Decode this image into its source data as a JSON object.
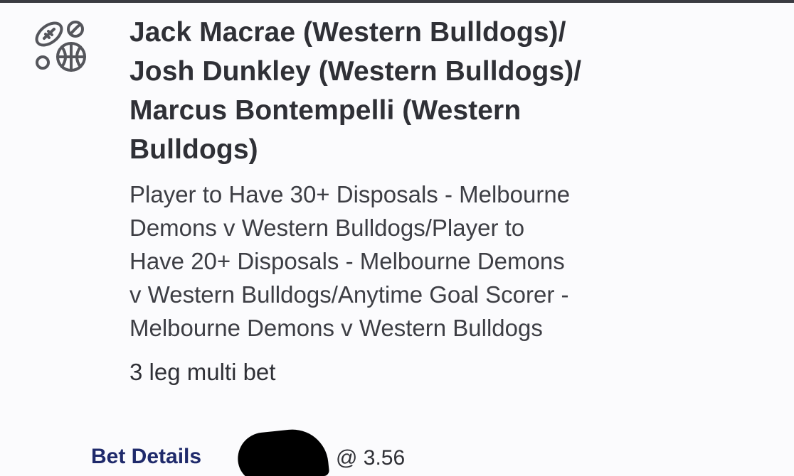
{
  "bet": {
    "title_lines": [
      "Jack Macrae (Western Bulldogs)/",
      "Josh Dunkley (Western Bulldogs)/",
      "Marcus Bontempelli (Western",
      "Bulldogs)"
    ],
    "description_lines": [
      "Player to Have 30+ Disposals - Melbourne",
      "Demons v Western Bulldogs/Player to",
      "Have 20+ Disposals - Melbourne Demons",
      "v Western Bulldogs/Anytime Goal Scorer -",
      "Melbourne Demons v Western Bulldogs"
    ],
    "bet_type": "3 leg multi bet"
  },
  "footer": {
    "details_label": "Bet Details",
    "odds_text": "@ 3.56"
  },
  "icon": {
    "name": "multi-sport-icon"
  },
  "colors": {
    "link": "#1f2a6b",
    "text": "#2f3036",
    "border": "#3b3c42"
  }
}
